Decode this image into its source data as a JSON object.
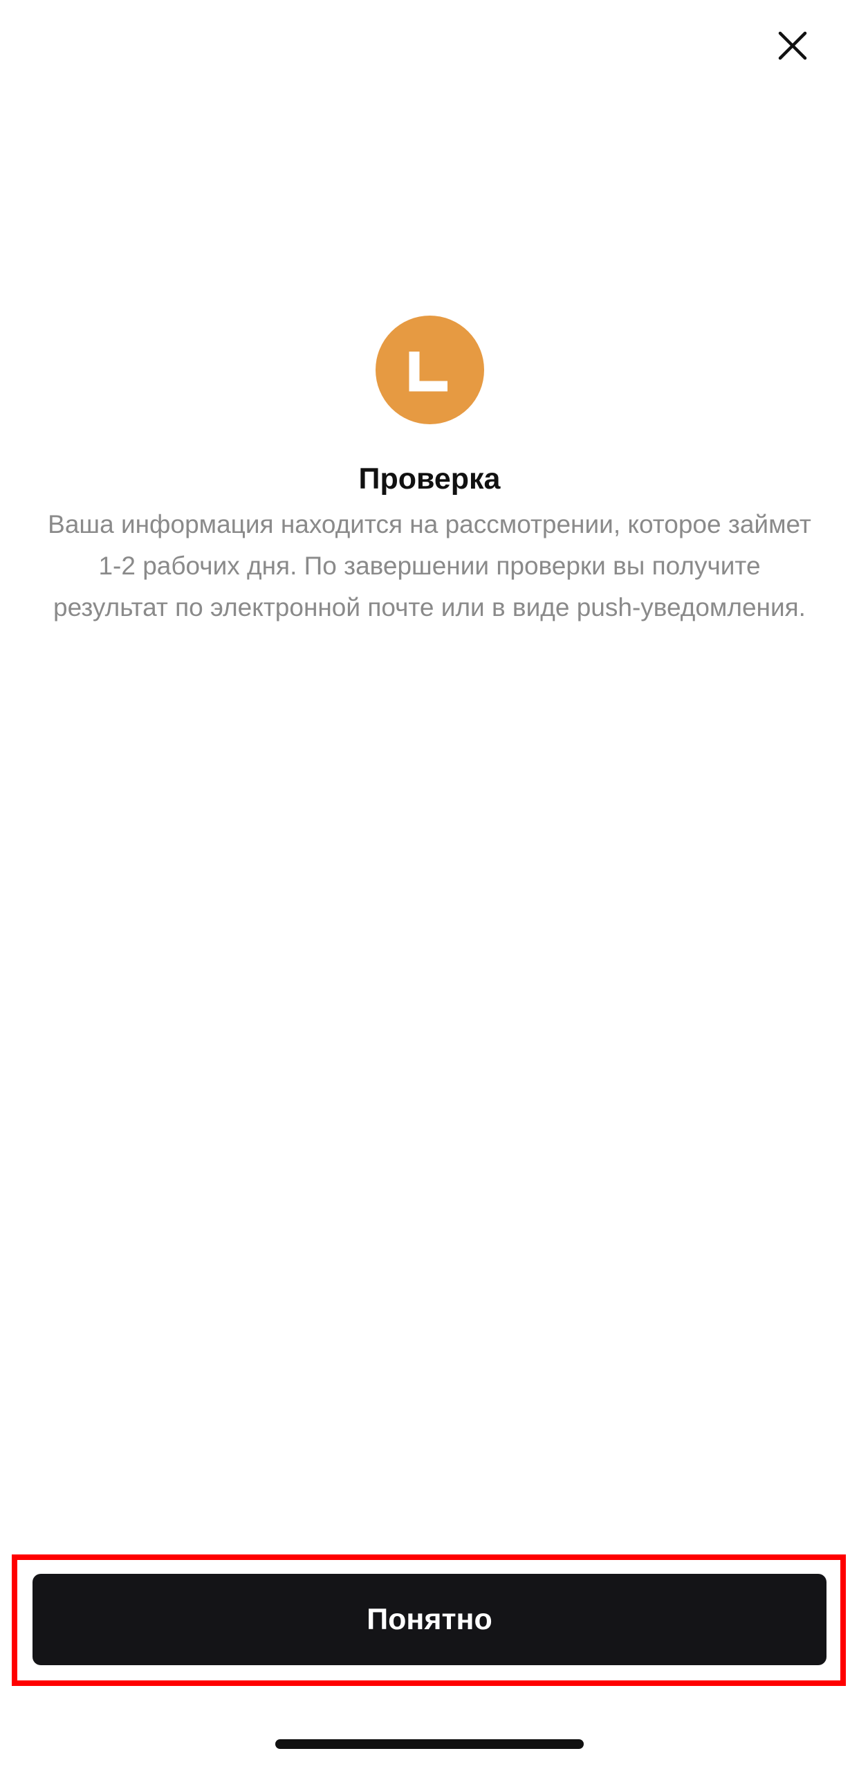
{
  "header": {
    "close_icon": "close-icon"
  },
  "status": {
    "icon": "pending-clock-icon",
    "color": "#e69a42",
    "title": "Проверка",
    "description": "Ваша информация находится на рассмотрении, которое займет 1-2 рабочих дня. По завершении проверки вы получите результат по электронной почте или в виде push-уведомления."
  },
  "footer": {
    "confirm_label": "Понятно",
    "button_color": "#141417",
    "highlight_color": "#ff0000"
  }
}
